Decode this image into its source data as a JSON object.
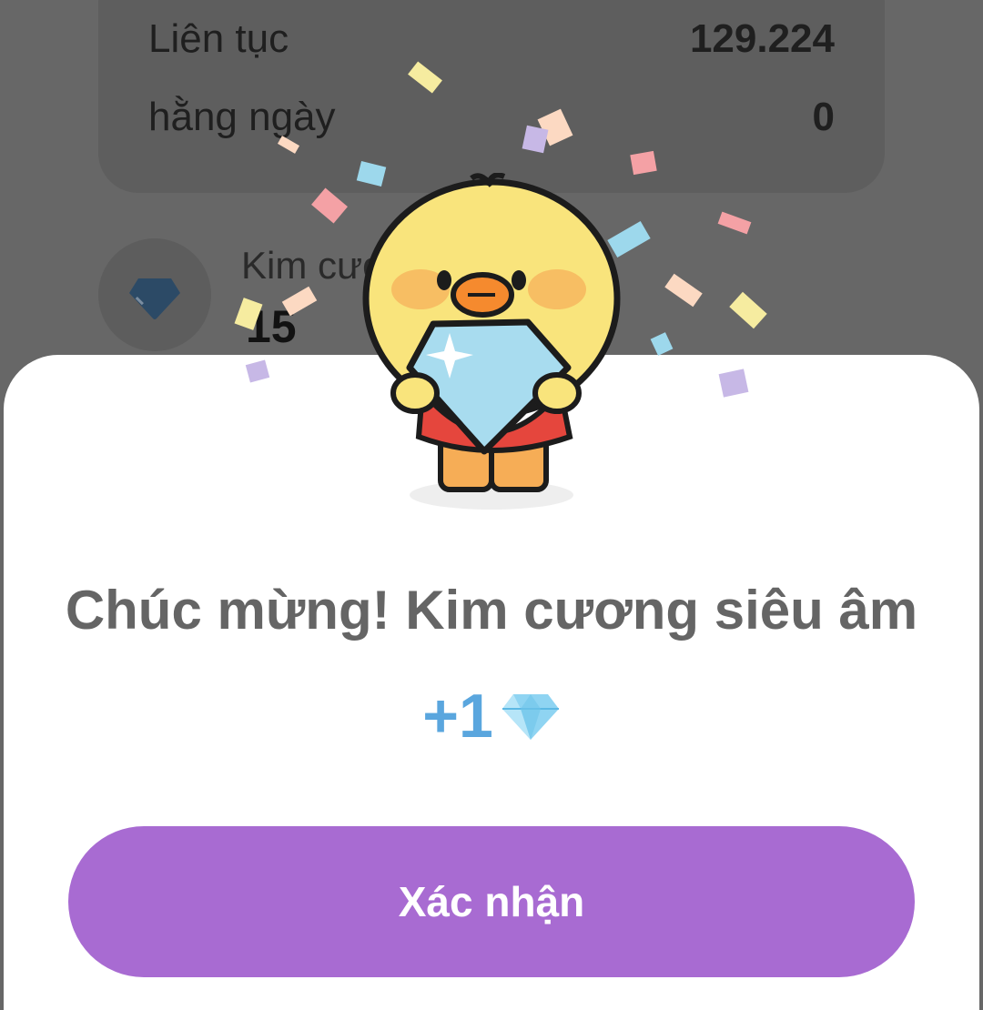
{
  "stats": {
    "consecutive_label": "Liên tục",
    "consecutive_value": "129.224",
    "daily_label": "hằng ngày",
    "daily_value": "0"
  },
  "owned": {
    "label": "Kim cương sở hữu",
    "value": "15",
    "icon": "diamond-icon"
  },
  "dialog": {
    "title": "Chúc mừng! Kim cương siêu âm",
    "reward_amount": "+1",
    "reward_icon": "diamond-icon",
    "confirm_label": "Xác nhận",
    "mascot": "duck-mascot-holding-diamond"
  },
  "colors": {
    "overlay": "#676767",
    "sheet": "#ffffff",
    "confirm_button": "#a86bd2",
    "reward_text": "#5aa6de",
    "title_text": "#656565"
  }
}
